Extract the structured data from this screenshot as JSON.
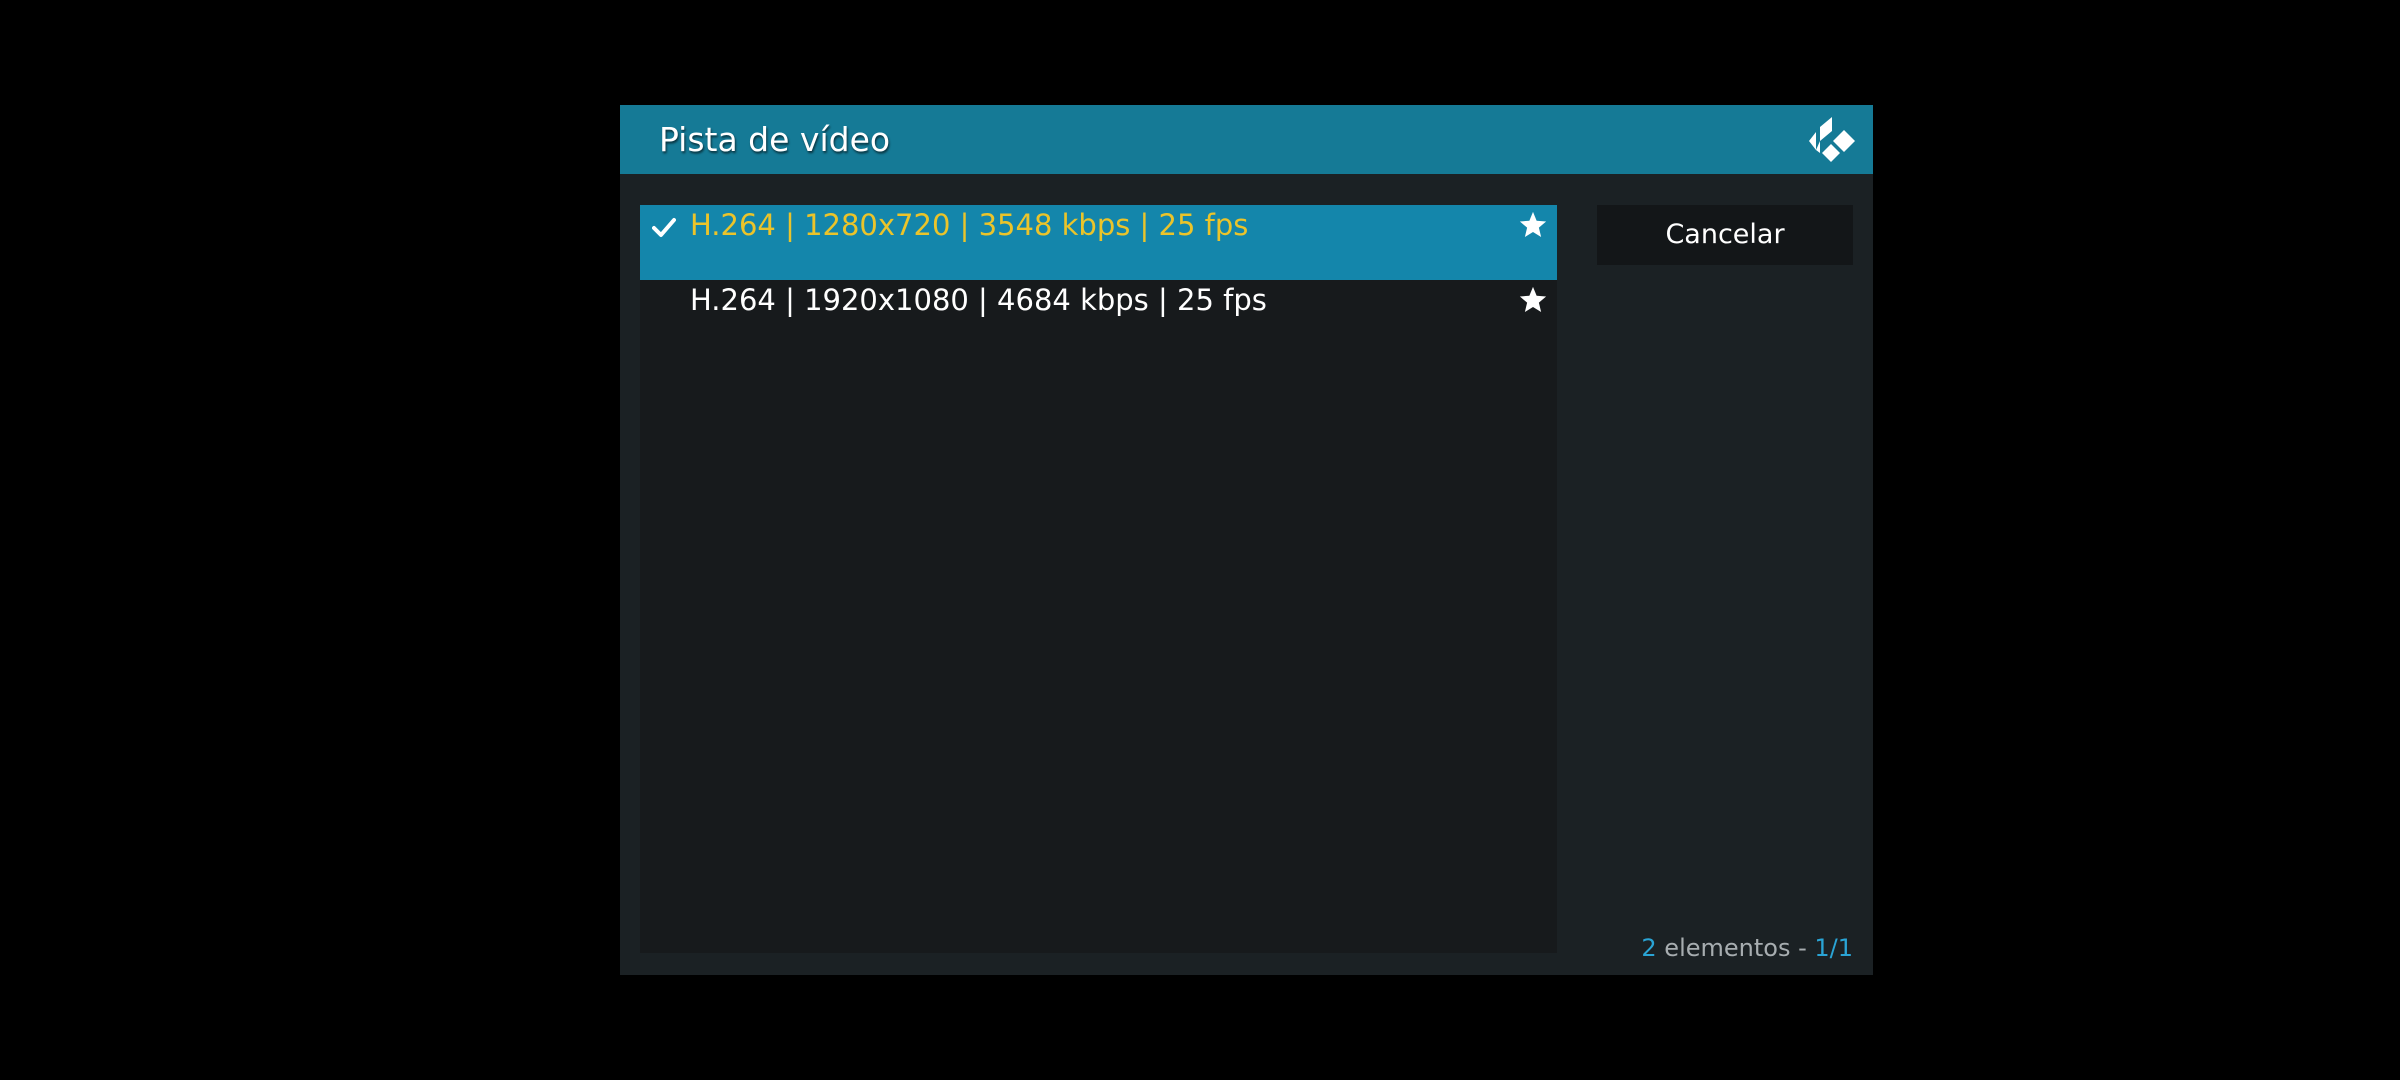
{
  "dialog": {
    "title": "Pista de vídeo",
    "logo_icon": "kodi-logo-icon"
  },
  "tracks": [
    {
      "label": "H.264 | 1280x720 | 3548 kbps | 25 fps",
      "selected": true,
      "checked": true,
      "star_icon": "star-icon",
      "check_icon": "checkmark-icon"
    },
    {
      "label": "H.264 | 1920x1080 | 4684 kbps | 25 fps",
      "selected": false,
      "checked": false,
      "star_icon": "star-icon"
    }
  ],
  "buttons": {
    "cancel_label": "Cancelar"
  },
  "footer": {
    "count": "2",
    "count_text": " elementos - ",
    "page": "1/1"
  },
  "colors": {
    "header_bg": "#157a96",
    "selected_bg": "#1486ab",
    "selected_text": "#ebc42a",
    "normal_text": "#ffffff",
    "accent": "#2aa4d5",
    "dialog_bg": "#1b2124",
    "list_bg": "#171a1c"
  }
}
